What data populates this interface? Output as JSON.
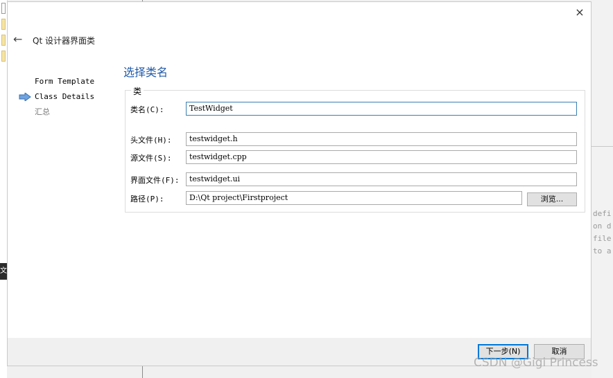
{
  "dialog": {
    "title": "Qt 设计器界面类",
    "close_icon": "×",
    "back_icon": "←"
  },
  "steps": [
    {
      "label": "Form Template",
      "state": "done"
    },
    {
      "label": "Class Details",
      "state": "current"
    },
    {
      "label": "汇总",
      "state": "pending"
    }
  ],
  "page": {
    "heading": "选择类名",
    "group_title": "类"
  },
  "fields": {
    "class_name": {
      "label": "类名(C):",
      "value": "TestWidget"
    },
    "header_file": {
      "label": "头文件(H):",
      "value": "testwidget.h"
    },
    "source_file": {
      "label": "源文件(S):",
      "value": "testwidget.cpp"
    },
    "form_file": {
      "label": "界面文件(F):",
      "value": "testwidget.ui"
    },
    "path": {
      "label": "路径(P):",
      "value": "D:\\Qt project\\Firstproject"
    }
  },
  "buttons": {
    "browse": "浏览...",
    "next": "下一步(N)",
    "cancel": "取消"
  },
  "background": {
    "right_code_lines": [
      "defi",
      "on d",
      "file",
      "to a"
    ],
    "left_tab_text": "文档"
  },
  "watermark": "CSDN @Gigi Princess",
  "colors": {
    "heading": "#1f5aa8",
    "focus_border": "#3c7fb1",
    "primary_border": "#0078d7"
  }
}
